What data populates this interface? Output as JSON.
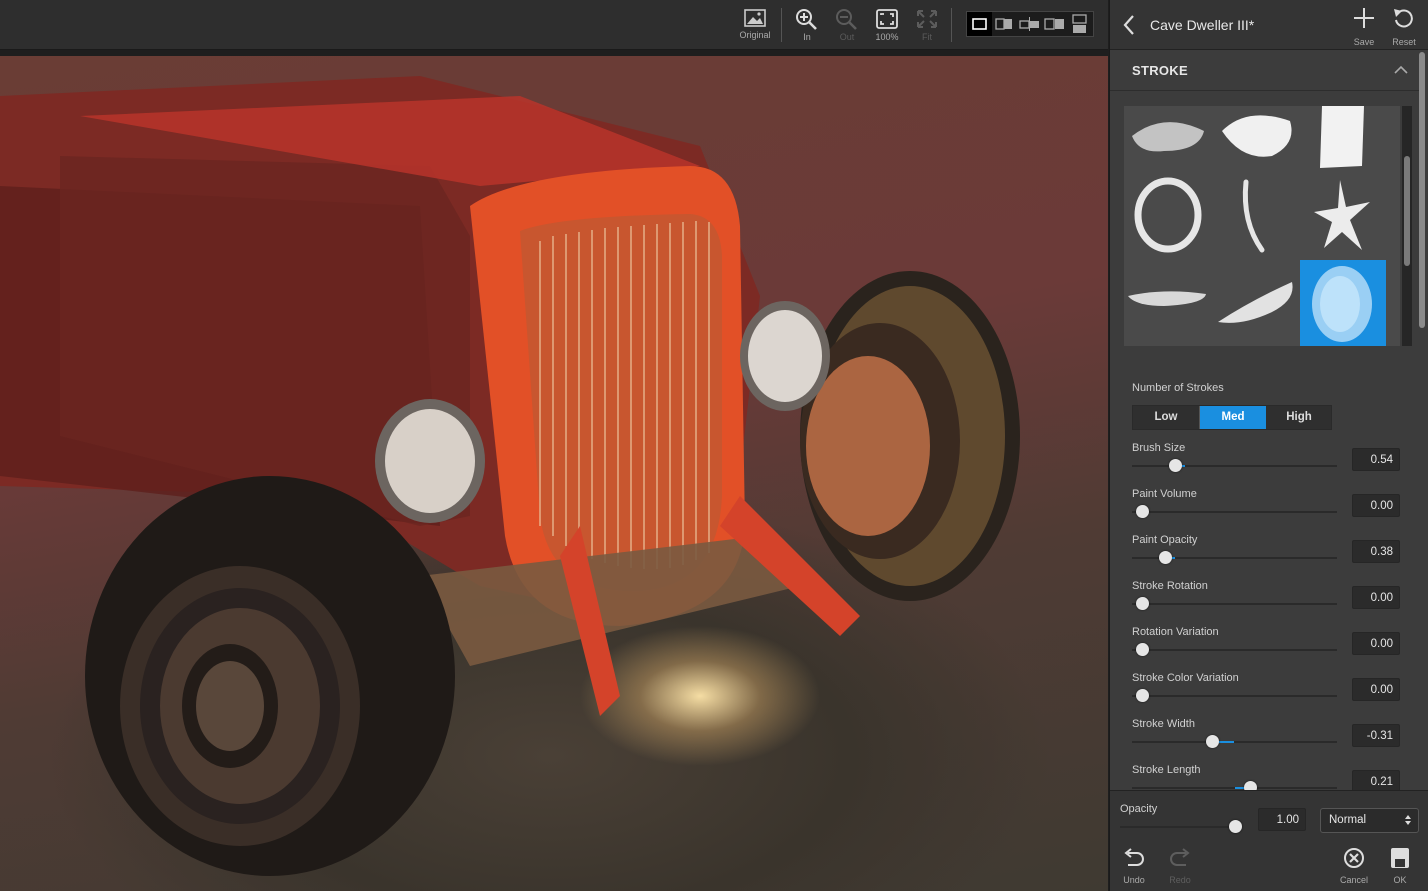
{
  "toolbar": {
    "original_label": "Original",
    "zoom_in_label": "In",
    "zoom_out_label": "Out",
    "zoom_100_label": "100%",
    "fit_label": "Fit"
  },
  "panel": {
    "title": "Cave Dweller III*",
    "save_label": "Save",
    "reset_label": "Reset",
    "section_title": "STROKE",
    "number_of_strokes": {
      "label": "Number of Strokes",
      "options": [
        "Low",
        "Med",
        "High"
      ],
      "selected": "Med"
    },
    "sliders": [
      {
        "label": "Brush Size",
        "value": "0.54",
        "level": 0.54,
        "bipolar": false
      },
      {
        "label": "Paint Volume",
        "value": "0.00",
        "level": 0.0,
        "bipolar": false
      },
      {
        "label": "Paint Opacity",
        "value": "0.38",
        "level": 0.38,
        "bipolar": false
      },
      {
        "label": "Stroke Rotation",
        "value": "0.00",
        "level": 0.0,
        "bipolar": false
      },
      {
        "label": "Rotation Variation",
        "value": "0.00",
        "level": 0.0,
        "bipolar": false
      },
      {
        "label": "Stroke Color Variation",
        "value": "0.00",
        "level": 0.0,
        "bipolar": false
      },
      {
        "label": "Stroke Width",
        "value": "-0.31",
        "level": -0.31,
        "bipolar": true
      },
      {
        "label": "Stroke Length",
        "value": "0.21",
        "level": 0.21,
        "bipolar": true
      }
    ],
    "opacity": {
      "label": "Opacity",
      "value": "1.00",
      "level": 1.0
    },
    "blend_mode": "Normal",
    "undo_label": "Undo",
    "redo_label": "Redo",
    "cancel_label": "Cancel",
    "ok_label": "OK"
  },
  "colors": {
    "accent": "#1a8fe0",
    "panel_bg": "#3c3c3c",
    "toolbar_bg": "#2e2e2e"
  }
}
